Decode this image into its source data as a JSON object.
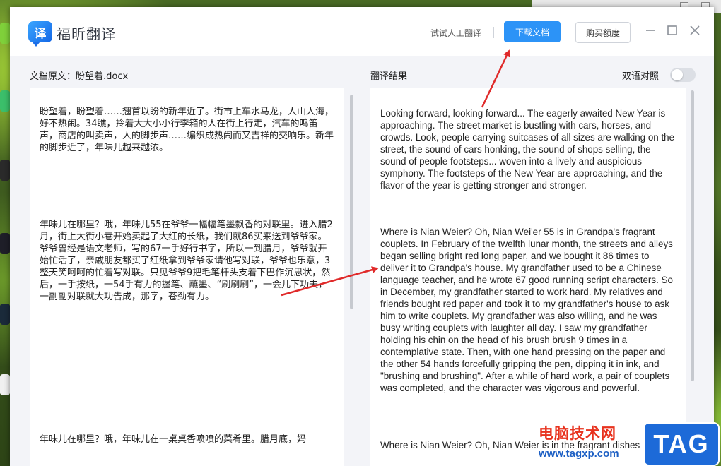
{
  "app": {
    "logo_char": "译",
    "title": "福昕翻译",
    "human_translation": "试试人工翻译",
    "download_label": "下载文档",
    "buy_label": "购买额度"
  },
  "source": {
    "label": "文档原文：盼望着.docx",
    "paragraphs": [
      "盼望着，盼望着……翘首以盼的新年近了。街市上车水马龙，人山人海，好不热闹。34瞧，拎着大大小小行李箱的人在街上行走，汽车的鸣笛声，商店的叫卖声，人的脚步声……编织成热闹而又吉祥的交响乐。新年的脚步近了，年味儿越来越浓。",
      "年味儿在哪里？哦，年味儿55在爷爷一幅幅笔墨飘香的对联里。进入腊2月，街上大街小巷开始卖起了大红的长纸，我们就86买来送到爷爷家。爷爷曾经是语文老师，写的67一手好行书字，所以一到腊月，爷爷就开始忙活了，亲戚朋友都买了红纸拿到爷爷家请他写对联，爷爷也乐意，3整天笑呵呵的忙着写对联。只见爷爷9把毛笔杆头支着下巴作沉思状，然后，一手按纸，一54手有力的握笔、蘸墨、“刷刷刷”，一会儿下功夫，一副副对联就大功告成，那字，苍劲有力。",
      "年味儿在哪里？哦，年味儿在一桌桌香喷喷的菜肴里。腊月底，妈"
    ]
  },
  "translation": {
    "label": "翻译结果",
    "bilingual_label": "双语对照",
    "bilingual_on": false,
    "paragraphs": [
      "Looking forward, looking forward... The eagerly awaited New Year is approaching. The street market is bustling with cars, horses, and crowds. Look, people carrying suitcases of all sizes are walking on the street, the sound of cars honking, the sound of shops selling, the sound of people footsteps... woven into a lively and auspicious symphony. The footsteps of the New Year are approaching, and the flavor of the year is getting stronger and stronger.",
      "Where is Nian Weier? Oh, Nian Wei'er 55 is in Grandpa's fragrant couplets. In February of the twelfth lunar month, the streets and alleys began selling bright red long paper, and we bought it 86 times to deliver it to Grandpa's house. My grandfather used to be a Chinese language teacher, and he wrote 67 good running script characters. So in December, my grandfather started to work hard. My relatives and friends bought red paper and took it to my grandfather's house to ask him to write couplets. My grandfather was also willing, and he was busy writing couplets with laughter all day. I saw my grandfather holding his chin on the head of his brush brush 9 times in a contemplative state. Then, with one hand pressing on the paper and the other 54 hands forcefully gripping the pen, dipping it in ink, and \"brushing and brushing\". After a while of hard work, a pair of couplets was completed, and the character was vigorous and powerful.",
      "Where is Nian Weier? Oh, Nian Weier is in the fragrant dishes"
    ]
  },
  "watermark": {
    "site_name": "电脑技术网",
    "url": "www.tagxp.com",
    "tag": "TAG"
  },
  "colors": {
    "accent": "#2c93f7",
    "annotation_arrow": "#e02a2a",
    "panel_bg": "#ffffff",
    "window_bg": "#f3f4f8"
  }
}
